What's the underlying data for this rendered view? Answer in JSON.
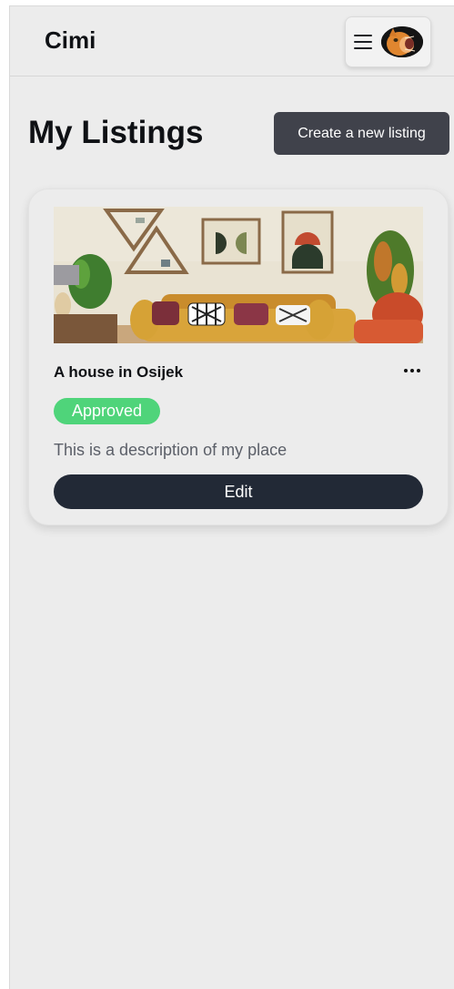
{
  "header": {
    "brand": "Cimi",
    "menu_icon": "hamburger-icon",
    "avatar": "cat-avatar"
  },
  "page": {
    "title": "My Listings",
    "create_button_label": "Create a new listing"
  },
  "listings": [
    {
      "title": "A house in Osijek",
      "status": "Approved",
      "description": "This is a description of my place",
      "edit_label": "Edit",
      "more_icon": "more-horizontal-icon",
      "image": "living-room-photo"
    }
  ],
  "colors": {
    "background": "#ececec",
    "primary_dark": "#222936",
    "create_button": "#40424b",
    "approved_badge": "#4fd47a",
    "description_text": "#5b5f68"
  }
}
